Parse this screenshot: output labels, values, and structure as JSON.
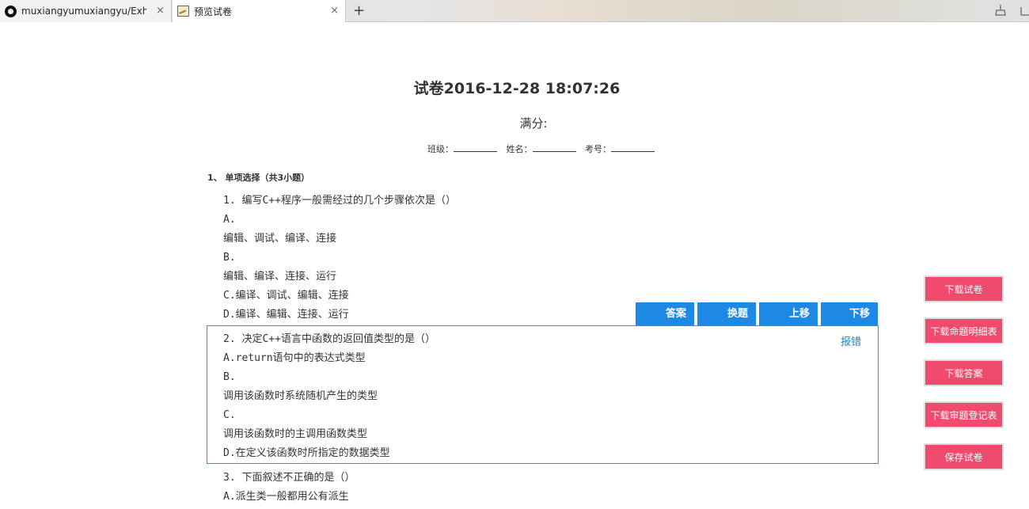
{
  "browser": {
    "tabs": [
      {
        "title": "muxiangyumuxiangyu/Exhau",
        "close": "×"
      },
      {
        "title": "预览试卷",
        "close": "×"
      }
    ],
    "new_tab": "+"
  },
  "paper": {
    "title": "试卷2016-12-28 18:07:26",
    "full_score_label": "满分:",
    "info": {
      "class_label": "班级：",
      "name_label": "姓名：",
      "id_label": "考号："
    },
    "section_title": "1、 单项选择（共3小题）"
  },
  "questions": [
    {
      "stem": "1. 编写C++程序一般需经过的几个步骤依次是（）",
      "lines": [
        "A.",
        "编辑、调试、编译、连接",
        "B.",
        "编辑、编译、连接、运行",
        "C.编译、调试、编辑、连接",
        "D.编译、编辑、连接、运行"
      ]
    },
    {
      "stem": "2. 决定C++语言中函数的返回值类型的是（）",
      "lines": [
        "A.return语句中的表达式类型",
        "B.",
        "调用该函数时系统随机产生的类型",
        "C.",
        "调用该函数时的主调用函数类型",
        "D.在定义该函数时所指定的数据类型"
      ]
    },
    {
      "stem": "3. 下面叙述不正确的是（）",
      "lines": [
        "A.派生类一般都用公有派生"
      ]
    }
  ],
  "question_actions": {
    "answer": "答案",
    "replace": "换题",
    "move_up": "上移",
    "move_down": "下移",
    "report": "报错"
  },
  "side_buttons": [
    "下载试卷",
    "下载命题明细表",
    "下载答案",
    "下载审题登记表",
    "保存试卷"
  ],
  "colors": {
    "action_blue": "#1e88e5",
    "side_red": "#f04a6e",
    "box_border": "#3a8fc2"
  }
}
